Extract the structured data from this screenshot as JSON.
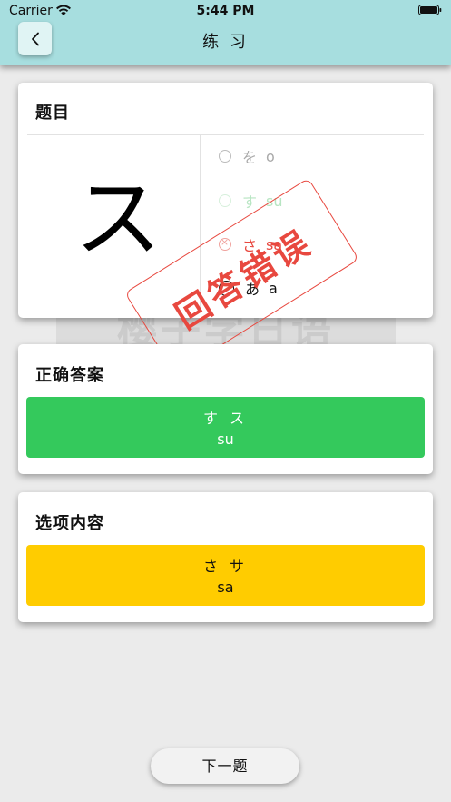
{
  "status_bar": {
    "carrier": "Carrier",
    "time": "5:44 PM",
    "wifi_icon": "wifi-icon",
    "battery_icon": "battery-icon"
  },
  "nav": {
    "title": "练 习",
    "back_icon": "chevron-left-icon"
  },
  "watermark": {
    "text": "樱子学日语"
  },
  "question": {
    "title": "题目",
    "character": "ス",
    "options": [
      {
        "kana": "を",
        "romaji": "o",
        "state": "faded"
      },
      {
        "kana": "す",
        "romaji": "su",
        "state": "faded-green"
      },
      {
        "kana": "さ",
        "romaji": "sa",
        "state": "wrong"
      },
      {
        "kana": "あ",
        "romaji": "a",
        "state": "normal"
      }
    ],
    "stamp_text": "回答错误"
  },
  "correct_answer": {
    "title": "正确答案",
    "kana": "す ス",
    "romaji": "su",
    "color": "#34c95c"
  },
  "chosen": {
    "title": "选项内容",
    "kana": "さ サ",
    "romaji": "sa",
    "color": "#ffcc00"
  },
  "next_button": {
    "label": "下一题"
  },
  "colors": {
    "header": "#a7dedf",
    "background": "#ebebeb",
    "error": "#e8483f"
  }
}
